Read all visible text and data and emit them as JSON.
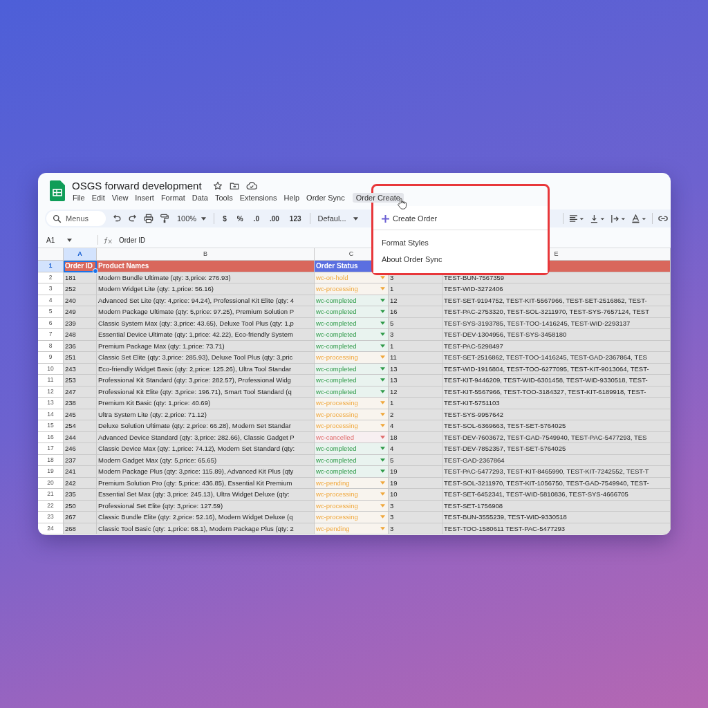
{
  "window": {
    "title": "OSGS forward development"
  },
  "menubar": {
    "items": [
      {
        "label": "File",
        "selected": false
      },
      {
        "label": "Edit",
        "selected": false
      },
      {
        "label": "View",
        "selected": false
      },
      {
        "label": "Insert",
        "selected": false
      },
      {
        "label": "Format",
        "selected": false
      },
      {
        "label": "Data",
        "selected": false
      },
      {
        "label": "Tools",
        "selected": false
      },
      {
        "label": "Extensions",
        "selected": false
      },
      {
        "label": "Help",
        "selected": false
      },
      {
        "label": "Order Sync",
        "selected": false
      },
      {
        "label": "Order Create",
        "selected": true
      }
    ]
  },
  "dropdown": {
    "items": [
      {
        "label": "Create Order",
        "kind": "action"
      },
      {
        "label": "Format Styles",
        "kind": "item"
      },
      {
        "label": "About Order Sync",
        "kind": "item"
      }
    ]
  },
  "toolbar": {
    "search_placeholder": "Menus",
    "zoom": "100%",
    "format_buttons": [
      "$",
      "%",
      ".0",
      ".00",
      "123"
    ],
    "font": "Defaul..."
  },
  "formula_bar": {
    "cell": "A1",
    "formula": "Order ID"
  },
  "sheet": {
    "columns": [
      {
        "letter": "A",
        "selected": true
      },
      {
        "letter": "B",
        "selected": false
      },
      {
        "letter": "C",
        "selected": false
      },
      {
        "letter": "E",
        "selected": false
      }
    ],
    "header_row": {
      "number": "1",
      "selected": true,
      "order_id": "Order ID",
      "product_names": "Product Names",
      "order_status": "Order Status"
    },
    "rows": [
      {
        "number": "2",
        "selected": false,
        "order_id": "181",
        "products": "Modern Bundle Ultimate (qty: 3,price: 276.93)",
        "status": {
          "text": "wc-on-hold",
          "color": "#f0a73a"
        },
        "column_4": "3",
        "column_5": "TEST-BUN-7567359"
      },
      {
        "number": "3",
        "selected": false,
        "order_id": "252",
        "products": "Modern Widget Lite (qty: 1,price: 56.16)",
        "status": {
          "text": "wc-processing",
          "color": "#f0a73a"
        },
        "column_4": "1",
        "column_5": "TEST-WID-3272406"
      },
      {
        "number": "4",
        "selected": false,
        "order_id": "240",
        "products": "Advanced Set Lite (qty: 4,price: 94.24), Professional Kit Elite (qty: 4",
        "status": {
          "text": "wc-completed",
          "color": "#2e9a48"
        },
        "column_4": "12",
        "column_5": "TEST-SET-9194752, TEST-KIT-5567966, TEST-SET-2516862, TEST-"
      },
      {
        "number": "5",
        "selected": false,
        "order_id": "249",
        "products": "Modern Package Ultimate (qty: 5,price: 97.25), Premium Solution P",
        "status": {
          "text": "wc-completed",
          "color": "#2e9a48"
        },
        "column_4": "16",
        "column_5": "TEST-PAC-2753320, TEST-SOL-3211970, TEST-SYS-7657124, TEST"
      },
      {
        "number": "6",
        "selected": false,
        "order_id": "239",
        "products": "Classic System Max (qty: 3,price: 43.65), Deluxe Tool Plus (qty: 1,p",
        "status": {
          "text": "wc-completed",
          "color": "#2e9a48"
        },
        "column_4": "5",
        "column_5": "TEST-SYS-3193785, TEST-TOO-1416245, TEST-WID-2293137"
      },
      {
        "number": "7",
        "selected": false,
        "order_id": "248",
        "products": "Essential Device Ultimate (qty: 1,price: 42.22), Eco-friendly System",
        "status": {
          "text": "wc-completed",
          "color": "#2e9a48"
        },
        "column_4": "3",
        "column_5": "TEST-DEV-1304956, TEST-SYS-3458180"
      },
      {
        "number": "8",
        "selected": false,
        "order_id": "236",
        "products": "Premium Package Max (qty: 1,price: 73.71)",
        "status": {
          "text": "wc-completed",
          "color": "#2e9a48"
        },
        "column_4": "1",
        "column_5": "TEST-PAC-5298497"
      },
      {
        "number": "9",
        "selected": false,
        "order_id": "251",
        "products": "Classic Set Elite (qty: 3,price: 285.93), Deluxe Tool Plus (qty: 3,pric",
        "status": {
          "text": "wc-processing",
          "color": "#f0a73a"
        },
        "column_4": "11",
        "column_5": "TEST-SET-2516862, TEST-TOO-1416245, TEST-GAD-2367864, TES"
      },
      {
        "number": "10",
        "selected": false,
        "order_id": "243",
        "products": "Eco-friendly Widget Basic (qty: 2,price: 125.26), Ultra Tool Standar",
        "status": {
          "text": "wc-completed",
          "color": "#2e9a48"
        },
        "column_4": "13",
        "column_5": "TEST-WID-1916804, TEST-TOO-6277095, TEST-KIT-9013064, TEST-"
      },
      {
        "number": "11",
        "selected": false,
        "order_id": "253",
        "products": "Professional Kit Standard (qty: 3,price: 282.57), Professional Widg",
        "status": {
          "text": "wc-completed",
          "color": "#2e9a48"
        },
        "column_4": "13",
        "column_5": "TEST-KIT-9446209, TEST-WID-6301458, TEST-WID-9330518, TEST-"
      },
      {
        "number": "12",
        "selected": false,
        "order_id": "247",
        "products": "Professional Kit Elite (qty: 3,price: 196.71), Smart Tool Standard (q",
        "status": {
          "text": "wc-completed",
          "color": "#2e9a48"
        },
        "column_4": "12",
        "column_5": "TEST-KIT-5567966, TEST-TOO-3184327, TEST-KIT-6189918, TEST-"
      },
      {
        "number": "13",
        "selected": false,
        "order_id": "238",
        "products": "Premium Kit Basic (qty: 1,price: 40.69)",
        "status": {
          "text": "wc-processing",
          "color": "#f0a73a"
        },
        "column_4": "1",
        "column_5": "TEST-KIT-5751103"
      },
      {
        "number": "14",
        "selected": false,
        "order_id": "245",
        "products": "Ultra System Lite (qty: 2,price: 71.12)",
        "status": {
          "text": "wc-processing",
          "color": "#f0a73a"
        },
        "column_4": "2",
        "column_5": "TEST-SYS-9957642"
      },
      {
        "number": "15",
        "selected": false,
        "order_id": "254",
        "products": "Deluxe Solution Ultimate (qty: 2,price: 66.28), Modern Set Standar",
        "status": {
          "text": "wc-processing",
          "color": "#f0a73a"
        },
        "column_4": "4",
        "column_5": "TEST-SOL-6369663, TEST-SET-5764025"
      },
      {
        "number": "16",
        "selected": false,
        "order_id": "244",
        "products": "Advanced Device Standard (qty: 3,price: 282.66), Classic Gadget P",
        "status": {
          "text": "wc-cancelled",
          "color": "#e06b6b"
        },
        "column_4": "18",
        "column_5": "TEST-DEV-7603672, TEST-GAD-7549940, TEST-PAC-5477293, TES"
      },
      {
        "number": "17",
        "selected": false,
        "order_id": "246",
        "products": "Classic Device Max (qty: 1,price: 74.12), Modern Set Standard (qty:",
        "status": {
          "text": "wc-completed",
          "color": "#2e9a48"
        },
        "column_4": "4",
        "column_5": "TEST-DEV-7852357, TEST-SET-5764025"
      },
      {
        "number": "18",
        "selected": false,
        "order_id": "237",
        "products": "Modern Gadget Max (qty: 5,price: 65.65)",
        "status": {
          "text": "wc-completed",
          "color": "#2e9a48"
        },
        "column_4": "5",
        "column_5": "TEST-GAD-2367864"
      },
      {
        "number": "19",
        "selected": false,
        "order_id": "241",
        "products": "Modern Package Plus (qty: 3,price: 115.89), Advanced Kit Plus (qty",
        "status": {
          "text": "wc-completed",
          "color": "#2e9a48"
        },
        "column_4": "19",
        "column_5": "TEST-PAC-5477293, TEST-KIT-8465990, TEST-KIT-7242552, TEST-T"
      },
      {
        "number": "20",
        "selected": false,
        "order_id": "242",
        "products": "Premium Solution Pro (qty: 5,price: 436.85), Essential Kit Premium",
        "status": {
          "text": "wc-pending",
          "color": "#f0a73a"
        },
        "column_4": "19",
        "column_5": "TEST-SOL-3211970, TEST-KIT-1056750, TEST-GAD-7549940, TEST-"
      },
      {
        "number": "21",
        "selected": false,
        "order_id": "235",
        "products": "Essential Set Max (qty: 3,price: 245.13), Ultra Widget Deluxe (qty:",
        "status": {
          "text": "wc-processing",
          "color": "#f0a73a"
        },
        "column_4": "10",
        "column_5": "TEST-SET-6452341, TEST-WID-5810836, TEST-SYS-4666705"
      },
      {
        "number": "22",
        "selected": false,
        "order_id": "250",
        "products": "Professional Set Elite (qty: 3,price: 127.59)",
        "status": {
          "text": "wc-processing",
          "color": "#f0a73a"
        },
        "column_4": "3",
        "column_5": "TEST-SET-1756908"
      },
      {
        "number": "23",
        "selected": false,
        "order_id": "267",
        "products": "Classic Bundle Elite (qty: 2,price: 52.16), Modern Widget Deluxe (q",
        "status": {
          "text": "wc-processing",
          "color": "#f0a73a"
        },
        "column_4": "3",
        "column_5": "TEST-BUN-3555239, TEST-WID-9330518"
      },
      {
        "number": "24",
        "selected": false,
        "order_id": "268",
        "products": "Classic Tool Basic (qty: 1,price: 68.1), Modern Package Plus (qty: 2",
        "status": {
          "text": "wc-pending",
          "color": "#f0a73a"
        },
        "column_4": "3",
        "column_5": "TEST-TOO-1580611 TEST-PAC-5477293"
      }
    ]
  }
}
